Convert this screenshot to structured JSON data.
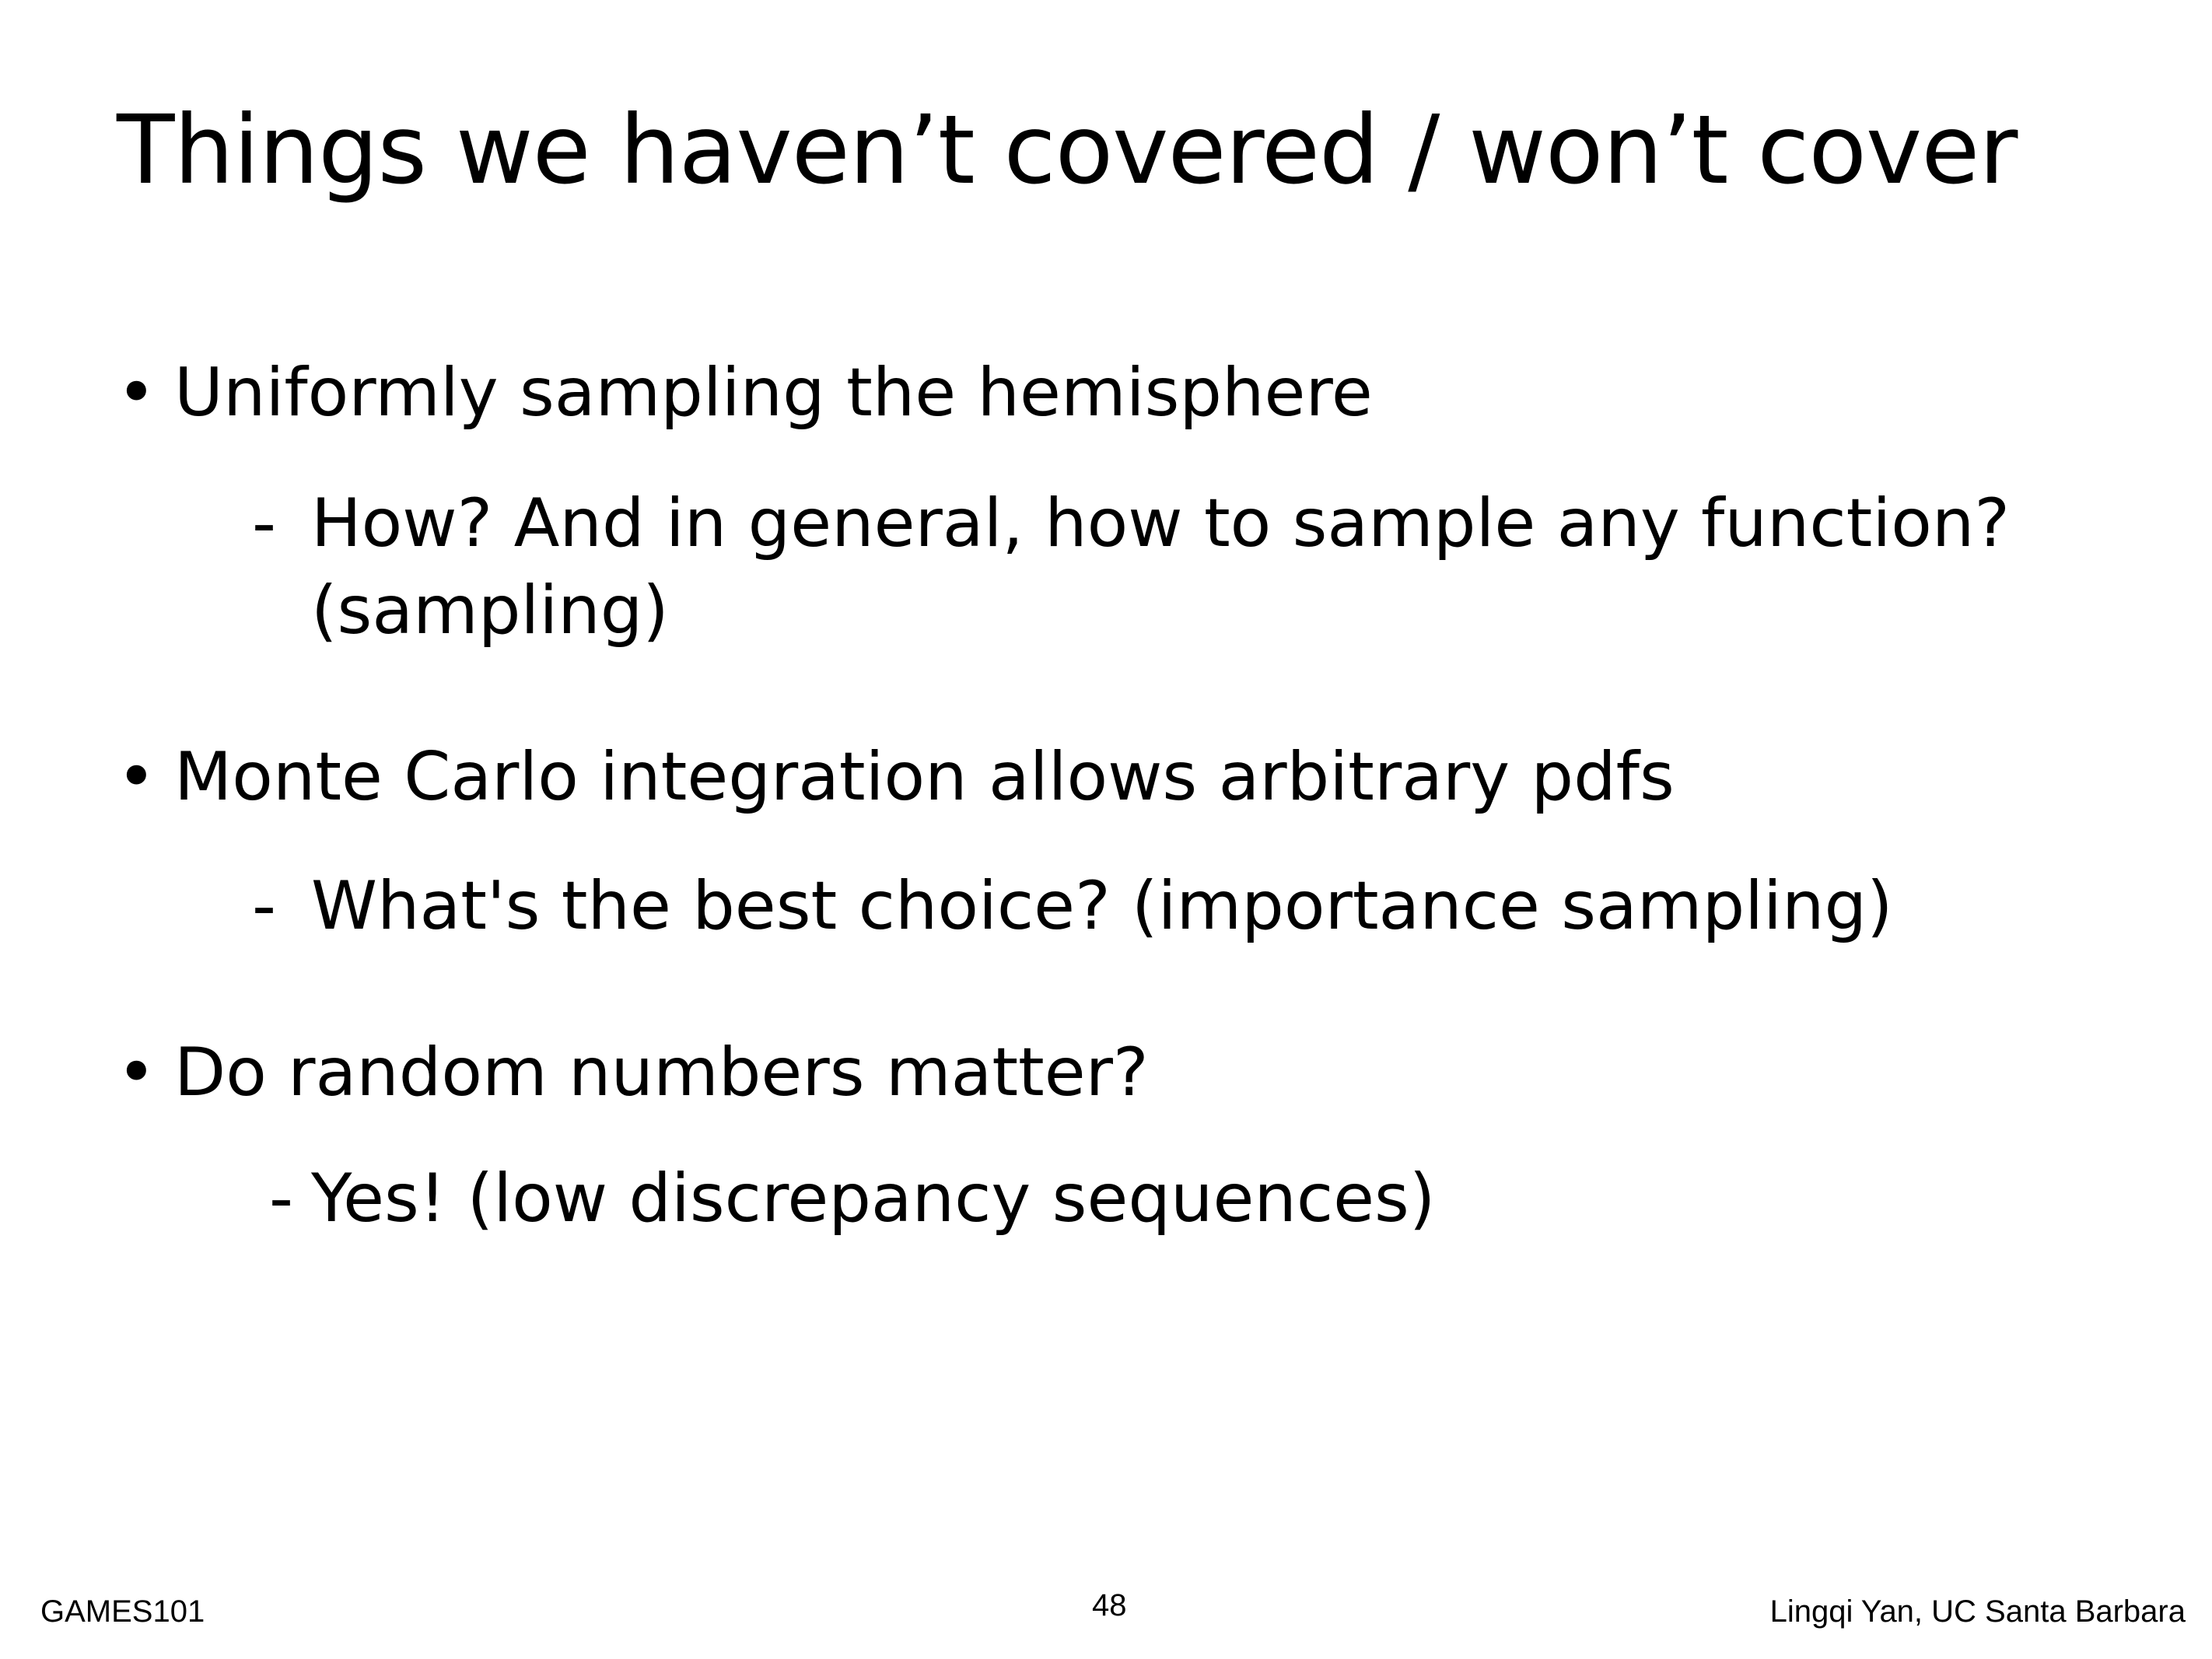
{
  "slide": {
    "title": "Things we haven’t covered / won’t cover",
    "bullets": [
      {
        "text": "Uniformly sampling the hemisphere",
        "sub_dash": "-",
        "sub_line1": "How? And in general, how to sample any function?",
        "sub_line2": "(sampling)"
      },
      {
        "text": "Monte Carlo integration allows arbitrary pdfs",
        "sub_dash": "-",
        "sub_line1": "What's the best choice? (importance sampling)"
      },
      {
        "text": "Do random numbers matter?",
        "sub_dash": "-",
        "sub_line1": "Yes! (low discrepancy sequences)"
      }
    ],
    "bullet_glyph": "•"
  },
  "footer": {
    "left": "GAMES101",
    "page_number": "48",
    "right": "Lingqi Yan, UC Santa Barbara"
  }
}
